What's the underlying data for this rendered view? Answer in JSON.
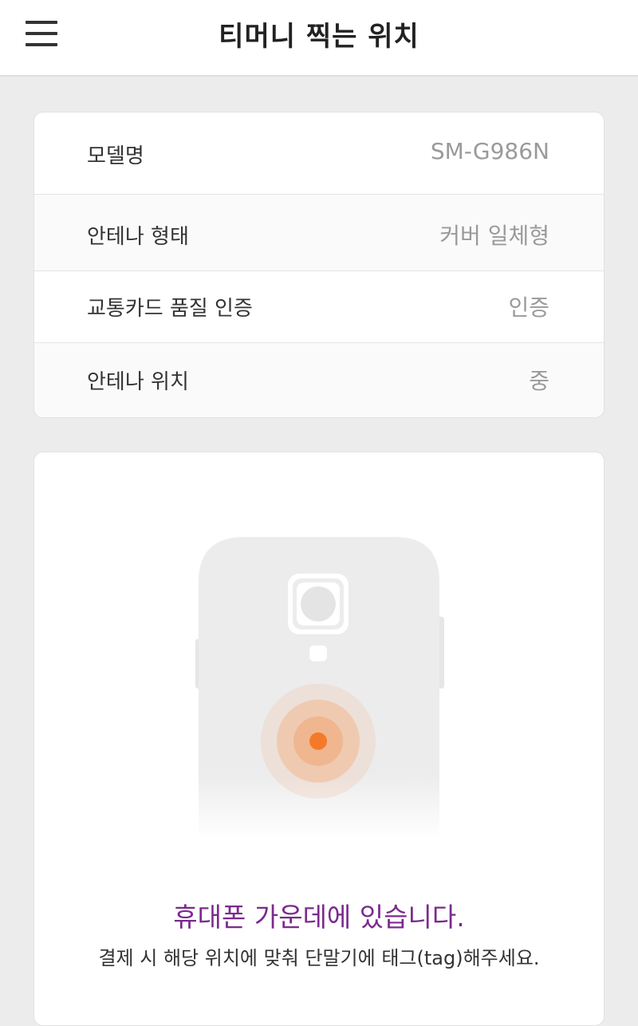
{
  "header": {
    "menu_icon": "hamburger-menu-icon",
    "title": "티머니 찍는 위치"
  },
  "info": {
    "rows": [
      {
        "label": "모델명",
        "value": "SM-G986N"
      },
      {
        "label": "안테나 형태",
        "value": "커버 일체형"
      },
      {
        "label": "교통카드 품질 인증",
        "value": "인증"
      },
      {
        "label": "안테나 위치",
        "value": "중"
      }
    ]
  },
  "visual": {
    "illustration": "phone-back-antenna-position",
    "highlight_color": "#f47a2a",
    "main_message": "휴대폰 가운데에 있습니다.",
    "sub_message": "결제 시 해당 위치에 맞춰 단말기에 태그(tag)해주세요."
  },
  "colors": {
    "accent_text": "#7b2a8e",
    "antenna_dot": "#f47a2a"
  }
}
